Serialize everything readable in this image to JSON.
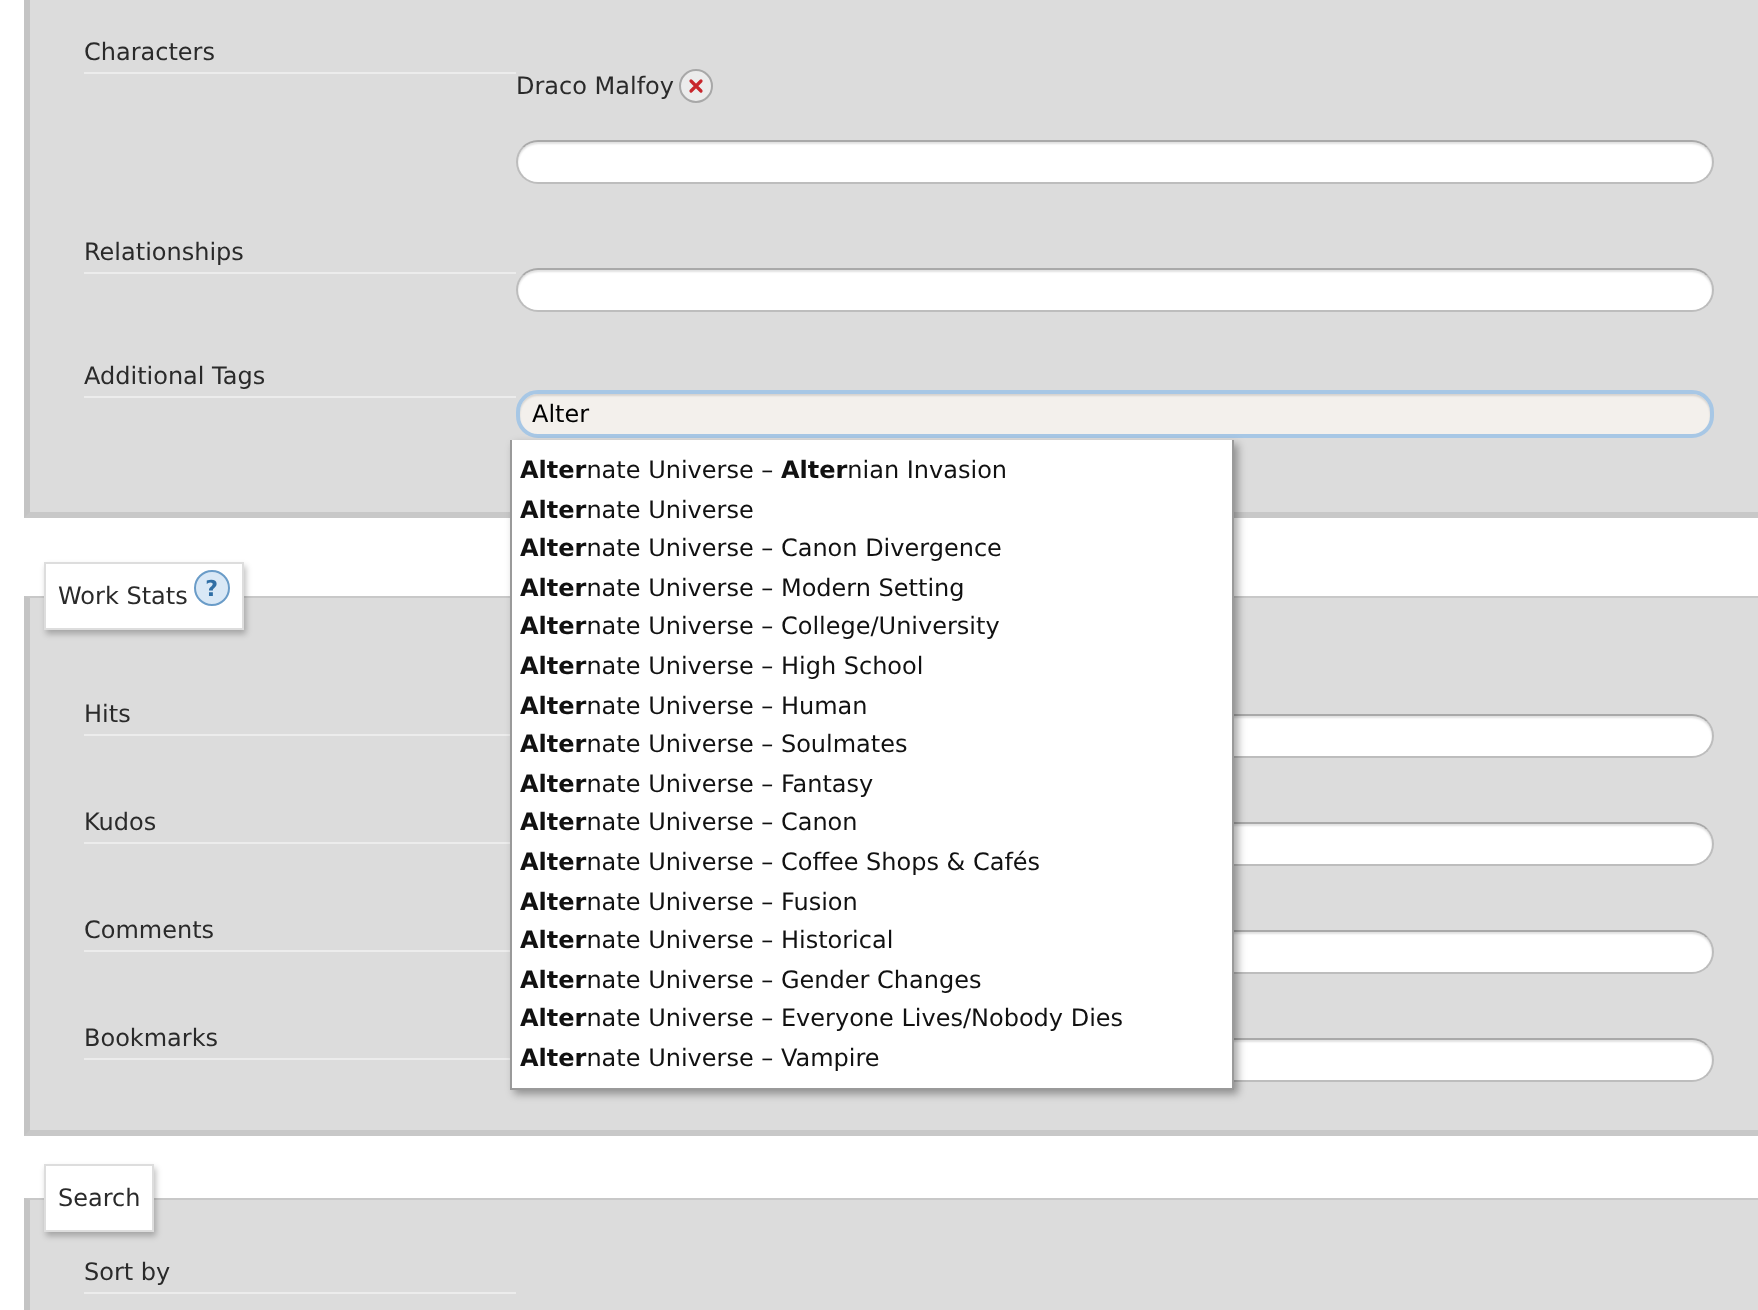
{
  "tags_panel": {
    "fields": [
      {
        "label": "Characters",
        "tags": [
          {
            "name": "Draco Malfoy"
          }
        ],
        "focused": false
      },
      {
        "label": "Relationships",
        "focused": false
      },
      {
        "label": "Additional Tags",
        "value": "Alter",
        "focused": true
      }
    ]
  },
  "autocomplete": {
    "items": [
      "**Alter**nate Universe – **Alter**nian Invasion",
      "**Alter**nate Universe",
      "**Alter**nate Universe – Canon Divergence",
      "**Alter**nate Universe – Modern Setting",
      "**Alter**nate Universe – College/University",
      "**Alter**nate Universe – High School",
      "**Alter**nate Universe – Human",
      "**Alter**nate Universe – Soulmates",
      "**Alter**nate Universe – Fantasy",
      "**Alter**nate Universe – Canon",
      "**Alter**nate Universe – Coffee Shops & Cafés",
      "**Alter**nate Universe – Fusion",
      "**Alter**nate Universe – Historical",
      "**Alter**nate Universe – Gender Changes",
      "**Alter**nate Universe – Everyone Lives/Nobody Dies",
      "**Alter**nate Universe – Vampire"
    ]
  },
  "work_stats": {
    "legend": "Work Stats",
    "help": "?",
    "fields": [
      {
        "label": "Hits",
        "focused": false
      },
      {
        "label": "Kudos",
        "focused": false
      },
      {
        "label": "Comments",
        "focused": false
      },
      {
        "label": "Bookmarks",
        "focused": false
      }
    ]
  },
  "search": {
    "legend": "Search",
    "fields": [
      {
        "label": "Sort by"
      }
    ]
  }
}
